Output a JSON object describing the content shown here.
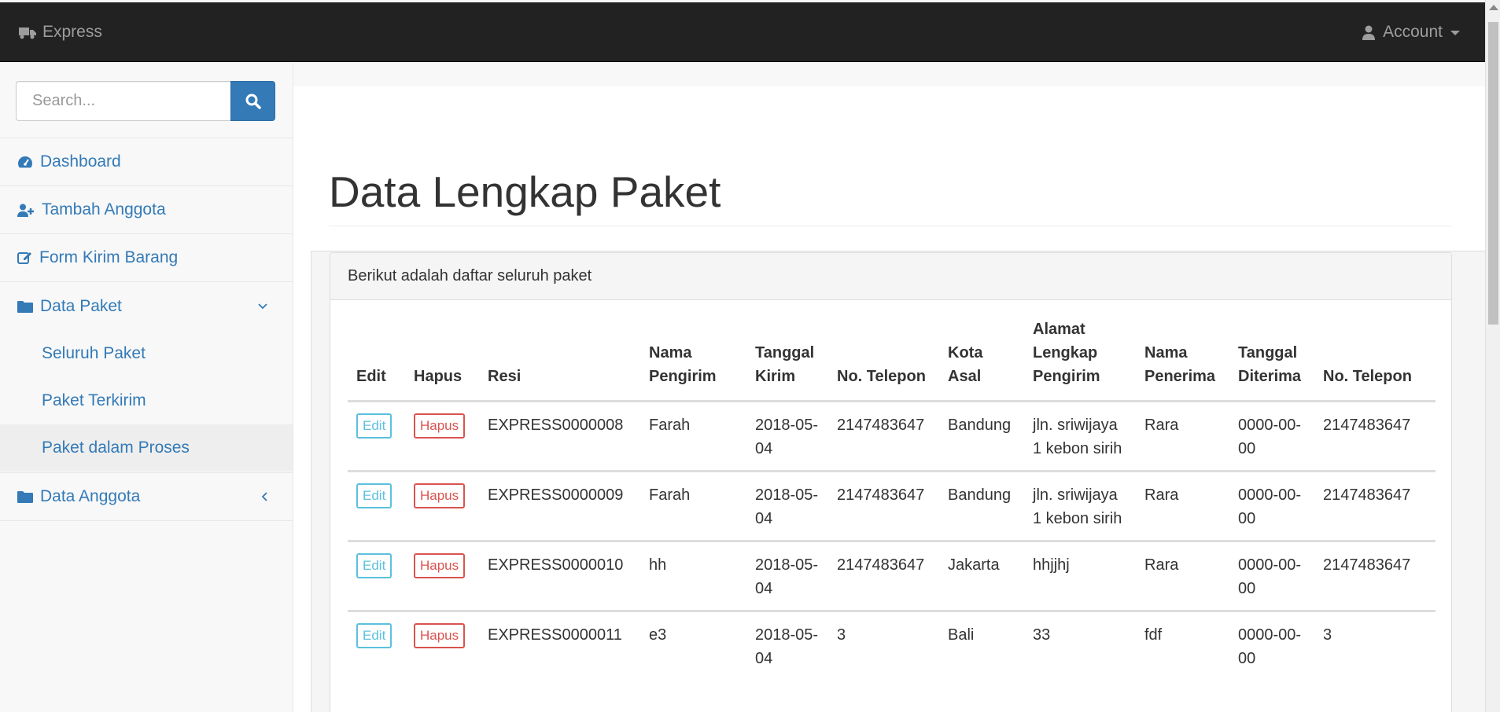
{
  "navbar": {
    "brand": "Express",
    "account": "Account"
  },
  "sidebar": {
    "search_placeholder": "Search...",
    "items": [
      {
        "label": "Dashboard",
        "icon": "dashboard-icon"
      },
      {
        "label": "Tambah Anggota",
        "icon": "user-plus-icon"
      },
      {
        "label": "Form Kirim Barang",
        "icon": "edit-icon"
      },
      {
        "label": "Data Paket",
        "icon": "folder-icon",
        "expanded": true,
        "children": [
          {
            "label": "Seluruh Paket"
          },
          {
            "label": "Paket Terkirim"
          },
          {
            "label": "Paket dalam Proses",
            "active": true
          }
        ]
      },
      {
        "label": "Data Anggota",
        "icon": "folder-icon",
        "expanded": false
      }
    ]
  },
  "main": {
    "title": "Data Lengkap Paket",
    "panel_heading": "Berikut adalah daftar seluruh paket",
    "columns": [
      "Edit",
      "Hapus",
      "Resi",
      "Nama Pengirim",
      "Tanggal Kirim",
      "No. Telepon",
      "Kota Asal",
      "Alamat Lengkap Pengirim",
      "Nama Penerima",
      "Tanggal Diterima",
      "No. Telepon"
    ],
    "edit_label": "Edit",
    "hapus_label": "Hapus",
    "rows": [
      {
        "resi": "EXPRESS0000008",
        "nama_pengirim": "Farah",
        "tanggal_kirim": "2018-05-04",
        "telepon": "2147483647",
        "kota_asal": "Bandung",
        "alamat": "jln. sriwijaya 1 kebon sirih",
        "nama_penerima": "Rara",
        "tanggal_diterima": "0000-00-00",
        "telepon_penerima": "2147483647"
      },
      {
        "resi": "EXPRESS0000009",
        "nama_pengirim": "Farah",
        "tanggal_kirim": "2018-05-04",
        "telepon": "2147483647",
        "kota_asal": "Bandung",
        "alamat": "jln. sriwijaya 1 kebon sirih",
        "nama_penerima": "Rara",
        "tanggal_diterima": "0000-00-00",
        "telepon_penerima": "2147483647"
      },
      {
        "resi": "EXPRESS0000010",
        "nama_pengirim": "hh",
        "tanggal_kirim": "2018-05-04",
        "telepon": "2147483647",
        "kota_asal": "Jakarta",
        "alamat": "hhjjhj",
        "nama_penerima": "Rara",
        "tanggal_diterima": "0000-00-00",
        "telepon_penerima": "2147483647"
      },
      {
        "resi": "EXPRESS0000011",
        "nama_pengirim": "e3",
        "tanggal_kirim": "2018-05-04",
        "telepon": "3",
        "kota_asal": "Bali",
        "alamat": "33",
        "nama_penerima": "fdf",
        "tanggal_diterima": "0000-00-00",
        "telepon_penerima": "3"
      }
    ]
  },
  "colors": {
    "navbar_bg": "#222222",
    "link": "#337ab7",
    "edit": "#5bc0de",
    "hapus": "#d9534f"
  }
}
